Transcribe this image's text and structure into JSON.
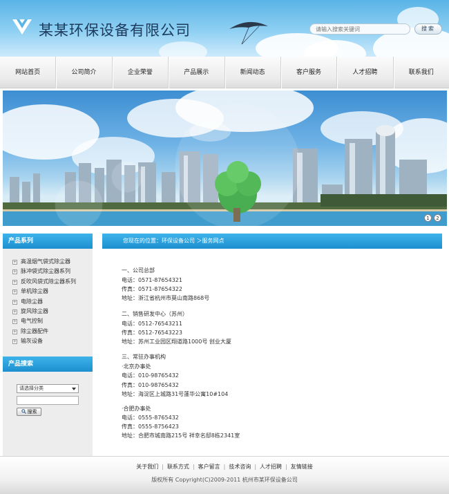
{
  "header": {
    "company_name": "某某环保设备有限公司",
    "search_placeholder": "请输入搜索关键词",
    "search_button": "搜索"
  },
  "nav": {
    "items": [
      {
        "label": "网站首页"
      },
      {
        "label": "公司简介"
      },
      {
        "label": "企业荣誉"
      },
      {
        "label": "产品展示"
      },
      {
        "label": "新闻动态"
      },
      {
        "label": "客户服务"
      },
      {
        "label": "人才招聘"
      },
      {
        "label": "联系我们"
      }
    ]
  },
  "banner": {
    "dots": [
      "1",
      "2"
    ]
  },
  "sidebar": {
    "products_title": "产品系列",
    "products": [
      "高温烟气袋式除尘器",
      "脉冲袋式除尘器系列",
      "反吹风袋式除尘器系列",
      "单机除尘器",
      "电除尘器",
      "旋风除尘器",
      "电气控制",
      "除尘器配件",
      "输灰设备"
    ],
    "search_title": "产品搜索",
    "category_select": "请选择分类",
    "search_button": "搜索"
  },
  "breadcrumb": "您现在的位置：环保设备公司 ＞服务网点",
  "content": {
    "sections": [
      {
        "title": "一、公司总部",
        "lines": [
          "电话：0571-87654321",
          "传真：0571-87654322",
          "地址：浙江省杭州市莫山南路868号"
        ]
      },
      {
        "title": "二、销售研发中心（苏州）",
        "lines": [
          "电话：0512-76543211",
          "传真：0512-76543223",
          "地址：苏州工业园区翔道路1000号 创业大厦"
        ]
      },
      {
        "title": "三、常驻办事机构",
        "lines": [
          "·北京办事处",
          "电话：010-98765432",
          "传真：010-98765432",
          "地址：海淀区上城路31号蓬华公寓10#104"
        ]
      },
      {
        "title": "",
        "lines": [
          "·合肥办事处",
          "电话：0555-8765432",
          "传真：0555-8756423",
          "地址：合肥市城南路215号 祥幸名邸8栋2341室"
        ]
      }
    ]
  },
  "footer": {
    "links": [
      "关于我们",
      "联系方式",
      "客户留言",
      "技术咨询",
      "人才招聘",
      "友情链接"
    ],
    "copyright": "版权所有 Copyright(C)2009-2011 杭州市某环保设备公司"
  }
}
